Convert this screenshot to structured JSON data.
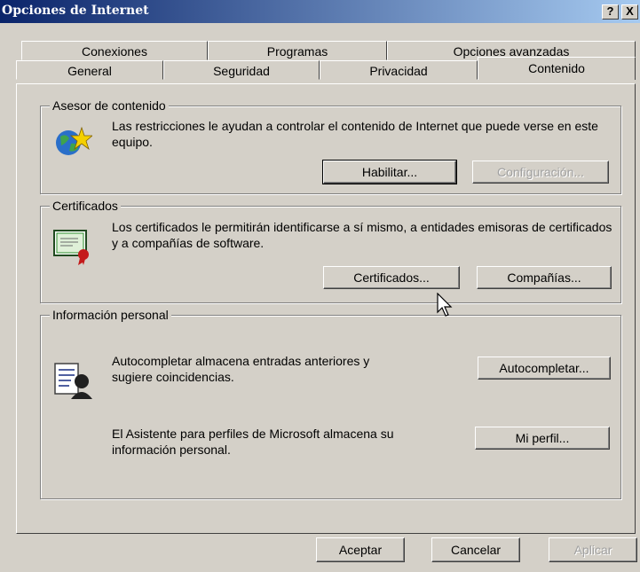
{
  "window": {
    "title": "Opciones de Internet",
    "help_glyph": "?",
    "close_glyph": "X"
  },
  "tabs": {
    "row_back": [
      "Conexiones",
      "Programas",
      "Opciones avanzadas"
    ],
    "row_front": [
      "General",
      "Seguridad",
      "Privacidad",
      "Contenido"
    ],
    "active": "Contenido"
  },
  "content_advisor": {
    "legend": "Asesor de contenido",
    "description": "Las restricciones le ayudan a controlar el contenido de Internet que puede verse en este equipo.",
    "enable_button": "Habilitar...",
    "settings_button": "Configuración..."
  },
  "certificates": {
    "legend": "Certificados",
    "description": "Los certificados le permitirán identificarse a sí mismo, a entidades emisoras de certificados y a compañías de software.",
    "certificates_button": "Certificados...",
    "publishers_button": "Compañías..."
  },
  "personal_info": {
    "legend": "Información personal",
    "autocomplete_text": "Autocompletar almacena entradas anteriores y sugiere coincidencias.",
    "autocomplete_button": "Autocompletar...",
    "profile_text": "El Asistente para perfiles de Microsoft almacena su información personal.",
    "profile_button": "Mi perfil..."
  },
  "footer": {
    "ok": "Aceptar",
    "cancel": "Cancelar",
    "apply": "Aplicar"
  },
  "icons": {
    "content_advisor": "globe-star-icon",
    "certificates": "certificate-icon",
    "autocomplete": "profile-card-icon",
    "cursor": "mouse-pointer-icon"
  }
}
